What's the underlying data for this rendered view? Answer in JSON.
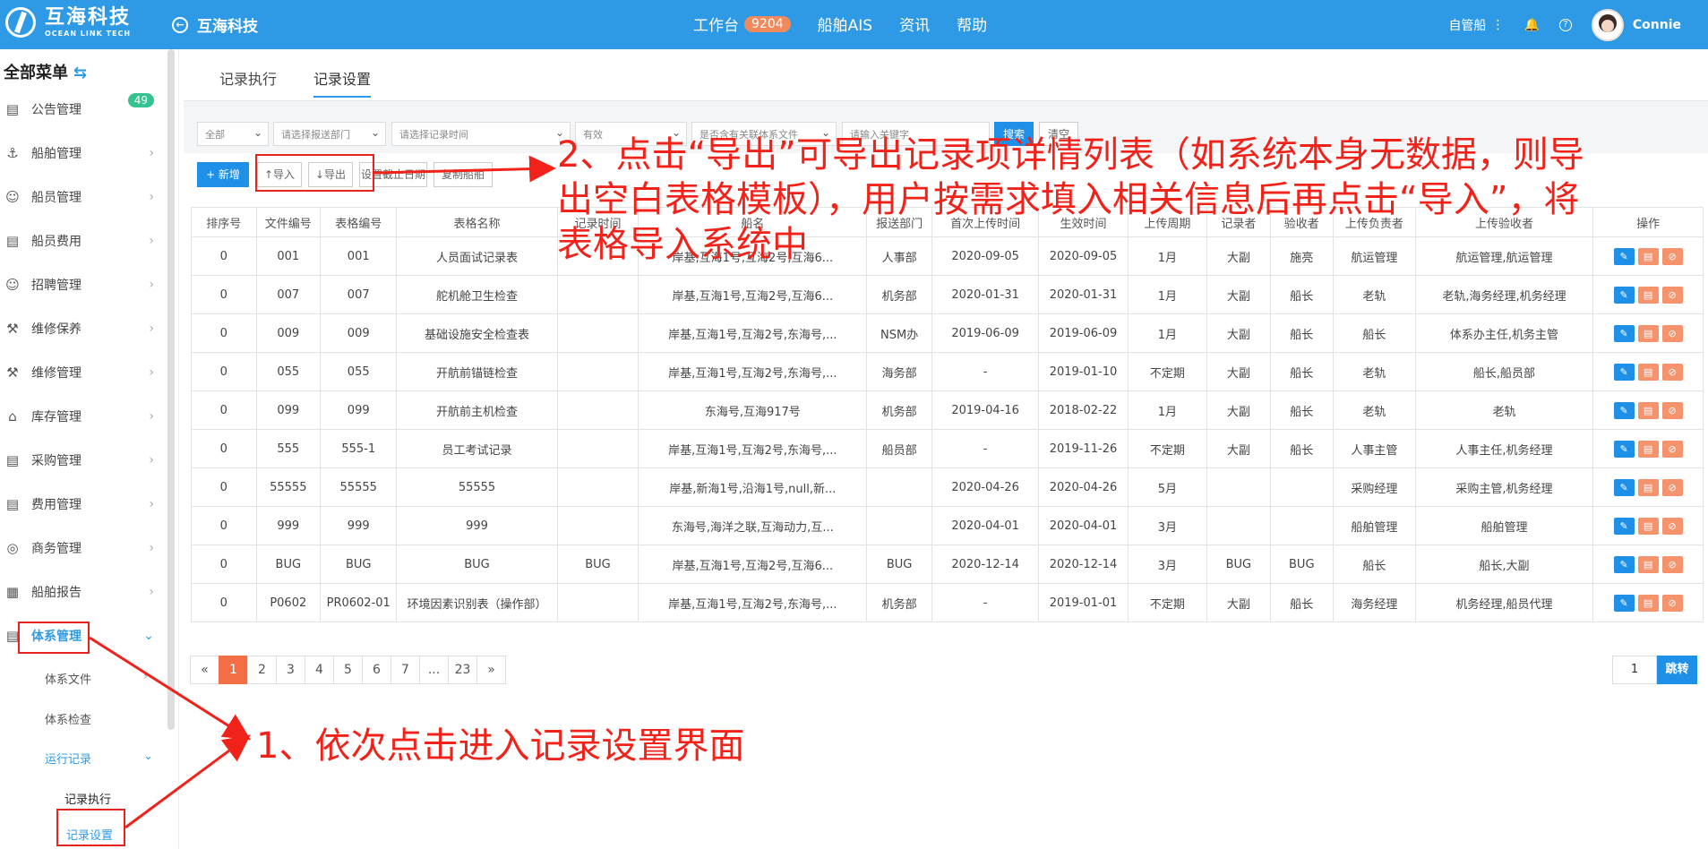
{
  "header": {
    "brand_cn": "互海科技",
    "brand_en": "OCEAN LINK TECH",
    "company": "互海科技",
    "nav": [
      {
        "label": "工作台",
        "badge": "9204"
      },
      {
        "label": "船舶AIS"
      },
      {
        "label": "资讯"
      },
      {
        "label": "帮助"
      }
    ],
    "ship_selector": "自管船",
    "user": "Connie"
  },
  "sidebar": {
    "title": "全部菜单",
    "items": [
      {
        "label": "公告管理",
        "count": "49"
      },
      {
        "label": "船舶管理"
      },
      {
        "label": "船员管理"
      },
      {
        "label": "船员费用"
      },
      {
        "label": "招聘管理"
      },
      {
        "label": "维修保养"
      },
      {
        "label": "维修管理"
      },
      {
        "label": "库存管理"
      },
      {
        "label": "采购管理"
      },
      {
        "label": "费用管理"
      },
      {
        "label": "商务管理"
      },
      {
        "label": "船舶报告"
      },
      {
        "label": "体系管理"
      }
    ],
    "sub": {
      "file": "体系文件",
      "check": "体系检查",
      "run": "运行记录",
      "exec": "记录执行",
      "setting": "记录设置"
    }
  },
  "tabs": [
    "记录执行",
    "记录设置"
  ],
  "filters": {
    "all": "全部",
    "dept": "请选择报送部门",
    "time": "请选择记录时间",
    "valid": "有效",
    "media": "是否含有关联体系文件",
    "keyword": "请输入关键字",
    "search": "搜索",
    "clear": "清空"
  },
  "toolbar": {
    "add": "+ 新增",
    "import": "导入",
    "export": "导出",
    "deadline": "设置截止日期",
    "copy": "复制船舶"
  },
  "table": {
    "headers": [
      "排序号",
      "文件编号",
      "表格编号",
      "表格名称",
      "记录时间",
      "船名",
      "报送部门",
      "首次上传时间",
      "生效时间",
      "上传周期",
      "记录者",
      "验收者",
      "上传负责者",
      "上传验收者",
      "操作"
    ],
    "rows": [
      [
        "0",
        "001",
        "001",
        "人员面试记录表",
        "",
        "岸基,互海1号,互海2号,互海6...",
        "人事部",
        "2020-09-05",
        "2020-09-05",
        "1月",
        "大副",
        "施亮",
        "航运管理",
        "航运管理,航运管理"
      ],
      [
        "0",
        "007",
        "007",
        "舵机舱卫生检查",
        "",
        "岸基,互海1号,互海2号,互海6...",
        "机务部",
        "2020-01-31",
        "2020-01-31",
        "1月",
        "大副",
        "船长",
        "老轨",
        "老轨,海务经理,机务经理"
      ],
      [
        "0",
        "009",
        "009",
        "基础设施安全检查表",
        "",
        "岸基,互海1号,互海2号,东海号,...",
        "NSM办",
        "2019-06-09",
        "2019-06-09",
        "1月",
        "大副",
        "船长",
        "船长",
        "体系办主任,机务主管"
      ],
      [
        "0",
        "055",
        "055",
        "开航前锚链检查",
        "",
        "岸基,互海1号,互海2号,东海号,...",
        "海务部",
        "-",
        "2019-01-10",
        "不定期",
        "大副",
        "船长",
        "老轨",
        "船长,船员部"
      ],
      [
        "0",
        "099",
        "099",
        "开航前主机检查",
        "",
        "东海号,互海917号",
        "机务部",
        "2019-04-16",
        "2018-02-22",
        "1月",
        "大副",
        "船长",
        "老轨",
        "老轨"
      ],
      [
        "0",
        "555",
        "555-1",
        "员工考试记录",
        "",
        "岸基,互海1号,互海2号,东海号,...",
        "船员部",
        "-",
        "2019-11-26",
        "不定期",
        "大副",
        "船长",
        "人事主管",
        "人事主任,机务经理"
      ],
      [
        "0",
        "55555",
        "55555",
        "55555",
        "",
        "岸基,新海1号,沿海1号,null,新...",
        "",
        "2020-04-26",
        "2020-04-26",
        "5月",
        "",
        "",
        "采购经理",
        "采购主管,机务经理"
      ],
      [
        "0",
        "999",
        "999",
        "999",
        "",
        "东海号,海洋之联,互海动力,互...",
        "",
        "2020-04-01",
        "2020-04-01",
        "3月",
        "",
        "",
        "船舶管理",
        "船舶管理"
      ],
      [
        "0",
        "BUG",
        "BUG",
        "BUG",
        "BUG",
        "岸基,互海1号,互海2号,互海6...",
        "BUG",
        "2020-12-14",
        "2020-12-14",
        "3月",
        "BUG",
        "BUG",
        "船长",
        "船长,大副"
      ],
      [
        "0",
        "P0602",
        "PR0602-01",
        "环境因素识别表（操作部）",
        "",
        "岸基,互海1号,互海2号,东海号,...",
        "机务部",
        "-",
        "2019-01-01",
        "不定期",
        "大副",
        "船长",
        "海务经理",
        "机务经理,船员代理"
      ]
    ]
  },
  "pager": {
    "prev": "«",
    "pages": [
      "1",
      "2",
      "3",
      "4",
      "5",
      "6",
      "7",
      "...",
      "23"
    ],
    "next": "»",
    "jump_value": "1",
    "jump": "跳转"
  },
  "annotations": {
    "a2_line1": "2、点击“导出”可导出记录项详情列表（如系统本身无数据，则导",
    "a2_line2": "出空白表格模板），用户按需求填入相关信息后再点击“导入”，将",
    "a2_line3": "表格导入系统中",
    "a1": "1、依次点击进入记录设置界面"
  },
  "colors": {
    "primary": "#2e9ae6",
    "accent": "#f36d45",
    "annotation": "#f1221a"
  }
}
